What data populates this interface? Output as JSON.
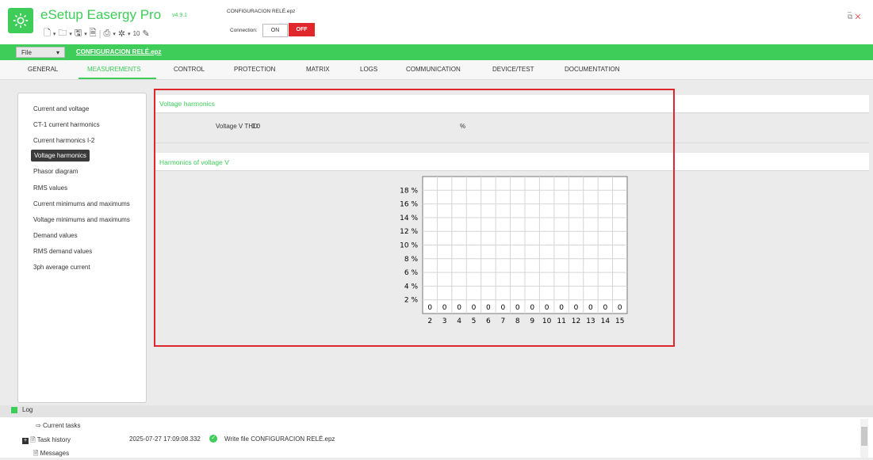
{
  "app": {
    "name": "eSetup Easergy Pro",
    "version": "v4.9.1",
    "config_title": "CONFIGURACION RELÉ.epz",
    "connection_label": "Connection:",
    "on_label": "ON",
    "off_label": "OFF",
    "window_controls": "_ ⧉"
  },
  "menu": {
    "file_label": "File",
    "file_link": "CONFIGURACION RELÉ.epz"
  },
  "tabs": [
    "GENERAL",
    "MEASUREMENTS",
    "CONTROL",
    "PROTECTION",
    "MATRIX",
    "LOGS",
    "COMMUNICATION",
    "DEVICE/TEST",
    "DOCUMENTATION"
  ],
  "sidebar": {
    "items": [
      "Current and voltage",
      "CT-1 current harmonics",
      "Current harmonics I-2",
      "Voltage harmonics",
      "Phasor diagram",
      "RMS values",
      "Current minimums and maximums",
      "Voltage minimums and maximums",
      "Demand values",
      "RMS demand values",
      "3ph average current"
    ],
    "active": "Voltage harmonics"
  },
  "voltage_harmonics": {
    "title": "Voltage harmonics",
    "thd_label": "Voltage V THD:",
    "thd_value": "0.0",
    "thd_unit": "%"
  },
  "harmonics_chart": {
    "title": "Harmonics of voltage V"
  },
  "chart_data": {
    "type": "bar",
    "categories": [
      "2",
      "3",
      "4",
      "5",
      "6",
      "7",
      "8",
      "9",
      "10",
      "11",
      "12",
      "13",
      "14",
      "15"
    ],
    "values": [
      0,
      0,
      0,
      0,
      0,
      0,
      0,
      0,
      0,
      0,
      0,
      0,
      0,
      0
    ],
    "y_ticks": [
      "18 %",
      "16 %",
      "14 %",
      "12 %",
      "10 %",
      "8 %",
      "6 %",
      "4 %",
      "2 %"
    ],
    "ylim": [
      0,
      20
    ],
    "grid": true
  },
  "log": {
    "title": "Log",
    "current_tasks": "Current tasks",
    "task_history": "Task history",
    "timestamp": "2025-07-27 17:09:08.332",
    "write_msg": "Write file CONFIGURACION RELÉ.epz",
    "messages": "Messages"
  },
  "colors": {
    "accent": "#3dcd58",
    "alert": "#e0282c"
  }
}
